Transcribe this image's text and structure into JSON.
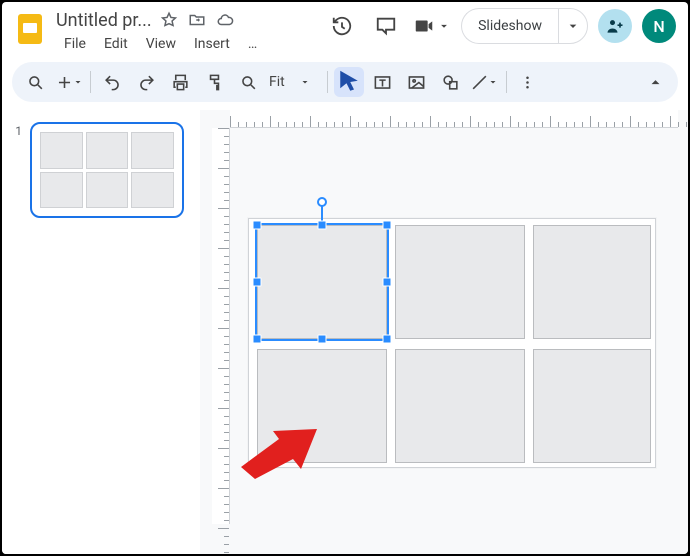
{
  "app": {
    "name": "Google Slides"
  },
  "doc": {
    "title": "Untitled pr..."
  },
  "title_icons": {
    "star": "star-outline",
    "move": "move-to-folder",
    "cloud": "cloud-saved"
  },
  "menubar": [
    "File",
    "Edit",
    "View",
    "Insert",
    "…"
  ],
  "topbar": {
    "history": "history",
    "comments": "comment",
    "video": "video-call",
    "slideshow_label": "Slideshow",
    "share": "share",
    "avatar_letter": "N"
  },
  "toolbar": {
    "search": "search",
    "new": "new-slide",
    "undo": "undo",
    "redo": "redo",
    "print": "print",
    "paint": "paint-format",
    "zoom_tool": "zoom",
    "zoom_label": "Fit",
    "select": "select",
    "textbox": "text-box",
    "image": "image",
    "shape": "shape",
    "line": "line",
    "more": "more",
    "collapse": "collapse"
  },
  "filmstrip": {
    "current_index": "1"
  },
  "selection": {
    "target": "placeholder-1"
  }
}
